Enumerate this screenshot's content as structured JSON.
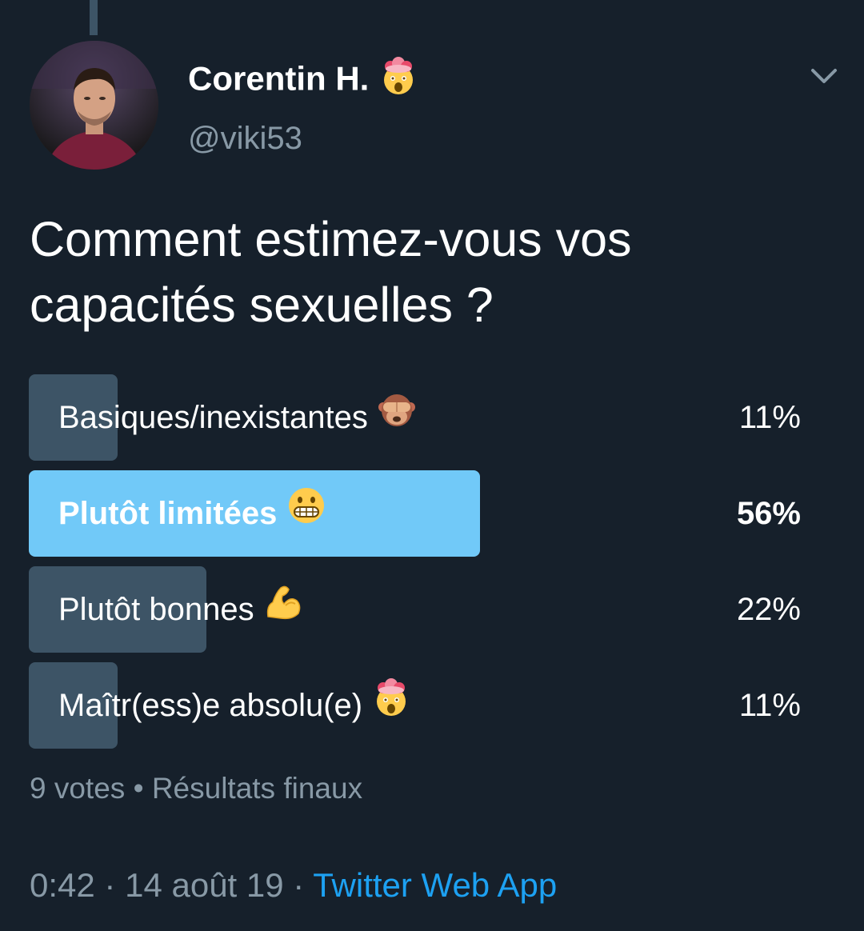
{
  "author": {
    "display_name": "Corentin H.",
    "name_emoji_icon": "exploding-head-icon",
    "handle": "@viki53"
  },
  "tweet": {
    "text": "Comment estimez-vous vos capacités sexuelles ?"
  },
  "poll": {
    "options": [
      {
        "label": "Basiques/inexistantes",
        "emoji_icon": "see-no-evil-monkey-icon",
        "percent_text": "11%",
        "share": 0.11,
        "winner": false
      },
      {
        "label": "Plutôt limitées",
        "emoji_icon": "grimacing-face-icon",
        "percent_text": "56%",
        "share": 0.56,
        "winner": true
      },
      {
        "label": "Plutôt bonnes",
        "emoji_icon": "flexed-biceps-icon",
        "percent_text": "22%",
        "share": 0.22,
        "winner": false
      },
      {
        "label": "Maîtr(ess)e absolu(e)",
        "emoji_icon": "exploding-head-icon",
        "percent_text": "11%",
        "share": 0.11,
        "winner": false
      }
    ],
    "votes": "9 votes",
    "separator": "•",
    "status": "Résultats finaux"
  },
  "meta": {
    "time": "0:42",
    "date": "14 août 19",
    "separator": "·",
    "source": "Twitter Web App"
  },
  "colors": {
    "background": "#16202b",
    "bar": "#3d5466",
    "bar_winner": "#71c9f8",
    "secondary_text": "#8899a6",
    "link": "#1da1f2"
  }
}
